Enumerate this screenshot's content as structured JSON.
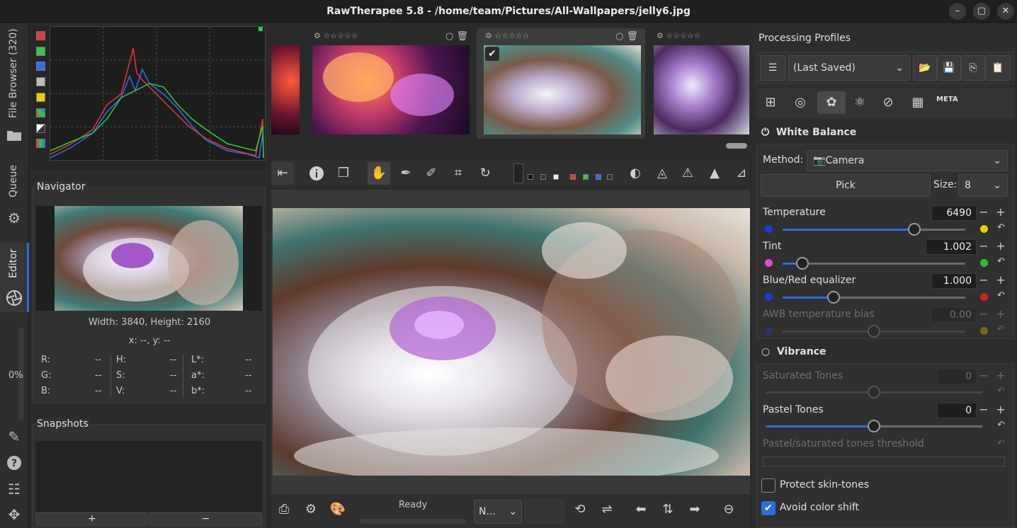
{
  "window": {
    "title": "RawTherapee 5.8 - /home/team/Pictures/All-Wallpapers/jelly6.jpg",
    "controls": [
      "–",
      "▢",
      "✕"
    ]
  },
  "left_tabs": {
    "file_browser": "File Browser (320)",
    "queue": "Queue",
    "editor": "Editor",
    "zoom_percent": "0%"
  },
  "navigator": {
    "title": "Navigator",
    "size": "Width: 3840, Height: 2160",
    "coords": "x: --, y: --",
    "readouts": [
      {
        "label": "R:",
        "value": "--"
      },
      {
        "label": "G:",
        "value": "--"
      },
      {
        "label": "B:",
        "value": "--"
      },
      {
        "label": "H:",
        "value": "--"
      },
      {
        "label": "S:",
        "value": "--"
      },
      {
        "label": "V:",
        "value": "--"
      },
      {
        "label": "L*:",
        "value": "--"
      },
      {
        "label": "a*:",
        "value": "--"
      },
      {
        "label": "b*:",
        "value": "--"
      }
    ]
  },
  "snapshots": {
    "title": "Snapshots",
    "add": "+",
    "remove": "−"
  },
  "filmstrip": {
    "stars": "☆☆☆☆☆"
  },
  "status": {
    "text": "Ready",
    "output_select": "N..."
  },
  "right_panel": {
    "profiles_title": "Processing Profiles",
    "profile_value": "(Last Saved)",
    "meta_tab": "META",
    "white_balance": {
      "title": "White Balance",
      "method_label": "Method:",
      "method_value": "Camera",
      "pick": "Pick",
      "size_label": "Size:",
      "size_value": "8",
      "temperature": {
        "label": "Temperature",
        "value": "6490",
        "level": 0.72
      },
      "tint": {
        "label": "Tint",
        "value": "1.002",
        "level": 0.11
      },
      "blue_red": {
        "label": "Blue/Red equalizer",
        "value": "1.000",
        "level": 0.28
      },
      "awb": {
        "label": "AWB temperature bias",
        "value": "0.00",
        "level": 0.5
      }
    },
    "vibrance": {
      "title": "Vibrance",
      "saturated": {
        "label": "Saturated Tones",
        "value": "0",
        "level": 0.5
      },
      "pastel": {
        "label": "Pastel Tones",
        "value": "0",
        "level": 0.5
      },
      "threshold": {
        "label": "Pastel/saturated tones threshold"
      },
      "protect_skin": {
        "label": "Protect skin-tones",
        "checked": false
      },
      "avoid_shift": {
        "label": "Avoid color shift",
        "checked": true
      }
    }
  },
  "colors": {
    "accent": "#2a6fdb",
    "hist_red": "#e53935",
    "hist_green": "#2ecc40",
    "hist_blue": "#2f6bff"
  }
}
